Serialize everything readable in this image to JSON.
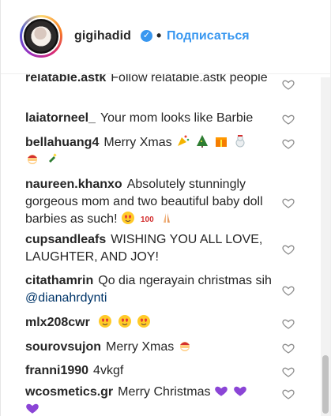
{
  "header": {
    "username": "gigihadid",
    "dot": "•",
    "follow_label": "Подписаться"
  },
  "comments": [
    {
      "user": "relatable.astk",
      "text": "Follow relatable.astk people"
    },
    {
      "user": "laiatorneel_",
      "text": "Your mom looks like Barbie"
    },
    {
      "user": "bellahuang4",
      "text": "Merry Xmas",
      "emojis": [
        "party-popper",
        "christmas-tree",
        "gift",
        "snowman",
        "santa",
        "champagne"
      ]
    },
    {
      "user": "naureen.khanxo",
      "text": "Absolutely stunningly gorgeous mom and two beautiful baby doll barbies as such!",
      "emojis": [
        "heart-eyes",
        "hundred",
        "folded-hands"
      ]
    },
    {
      "user": "cupsandleafs",
      "text": "WISHING YOU ALL LOVE, LAUGHTER, AND JOY!"
    },
    {
      "user": "citathamrin",
      "text": "Qo dia ngerayain christmas sih",
      "mention": "@dianahrdynti"
    },
    {
      "user": "mlx208cwr",
      "text": "",
      "emojis": [
        "heart-eyes",
        "heart-eyes",
        "heart-eyes"
      ]
    },
    {
      "user": "sourovsujon",
      "text": "Merry Xmas",
      "emojis": [
        "santa"
      ]
    },
    {
      "user": "franni1990",
      "text": "4vkgf"
    },
    {
      "user": "wcosmetics.gr",
      "text": "Merry Christmas",
      "emojis": [
        "purple-heart",
        "purple-heart",
        "purple-heart"
      ]
    }
  ],
  "colors": {
    "accent": "#3897f0",
    "text": "#262626",
    "mention": "#003569",
    "purple_heart": "#8b45d6"
  }
}
